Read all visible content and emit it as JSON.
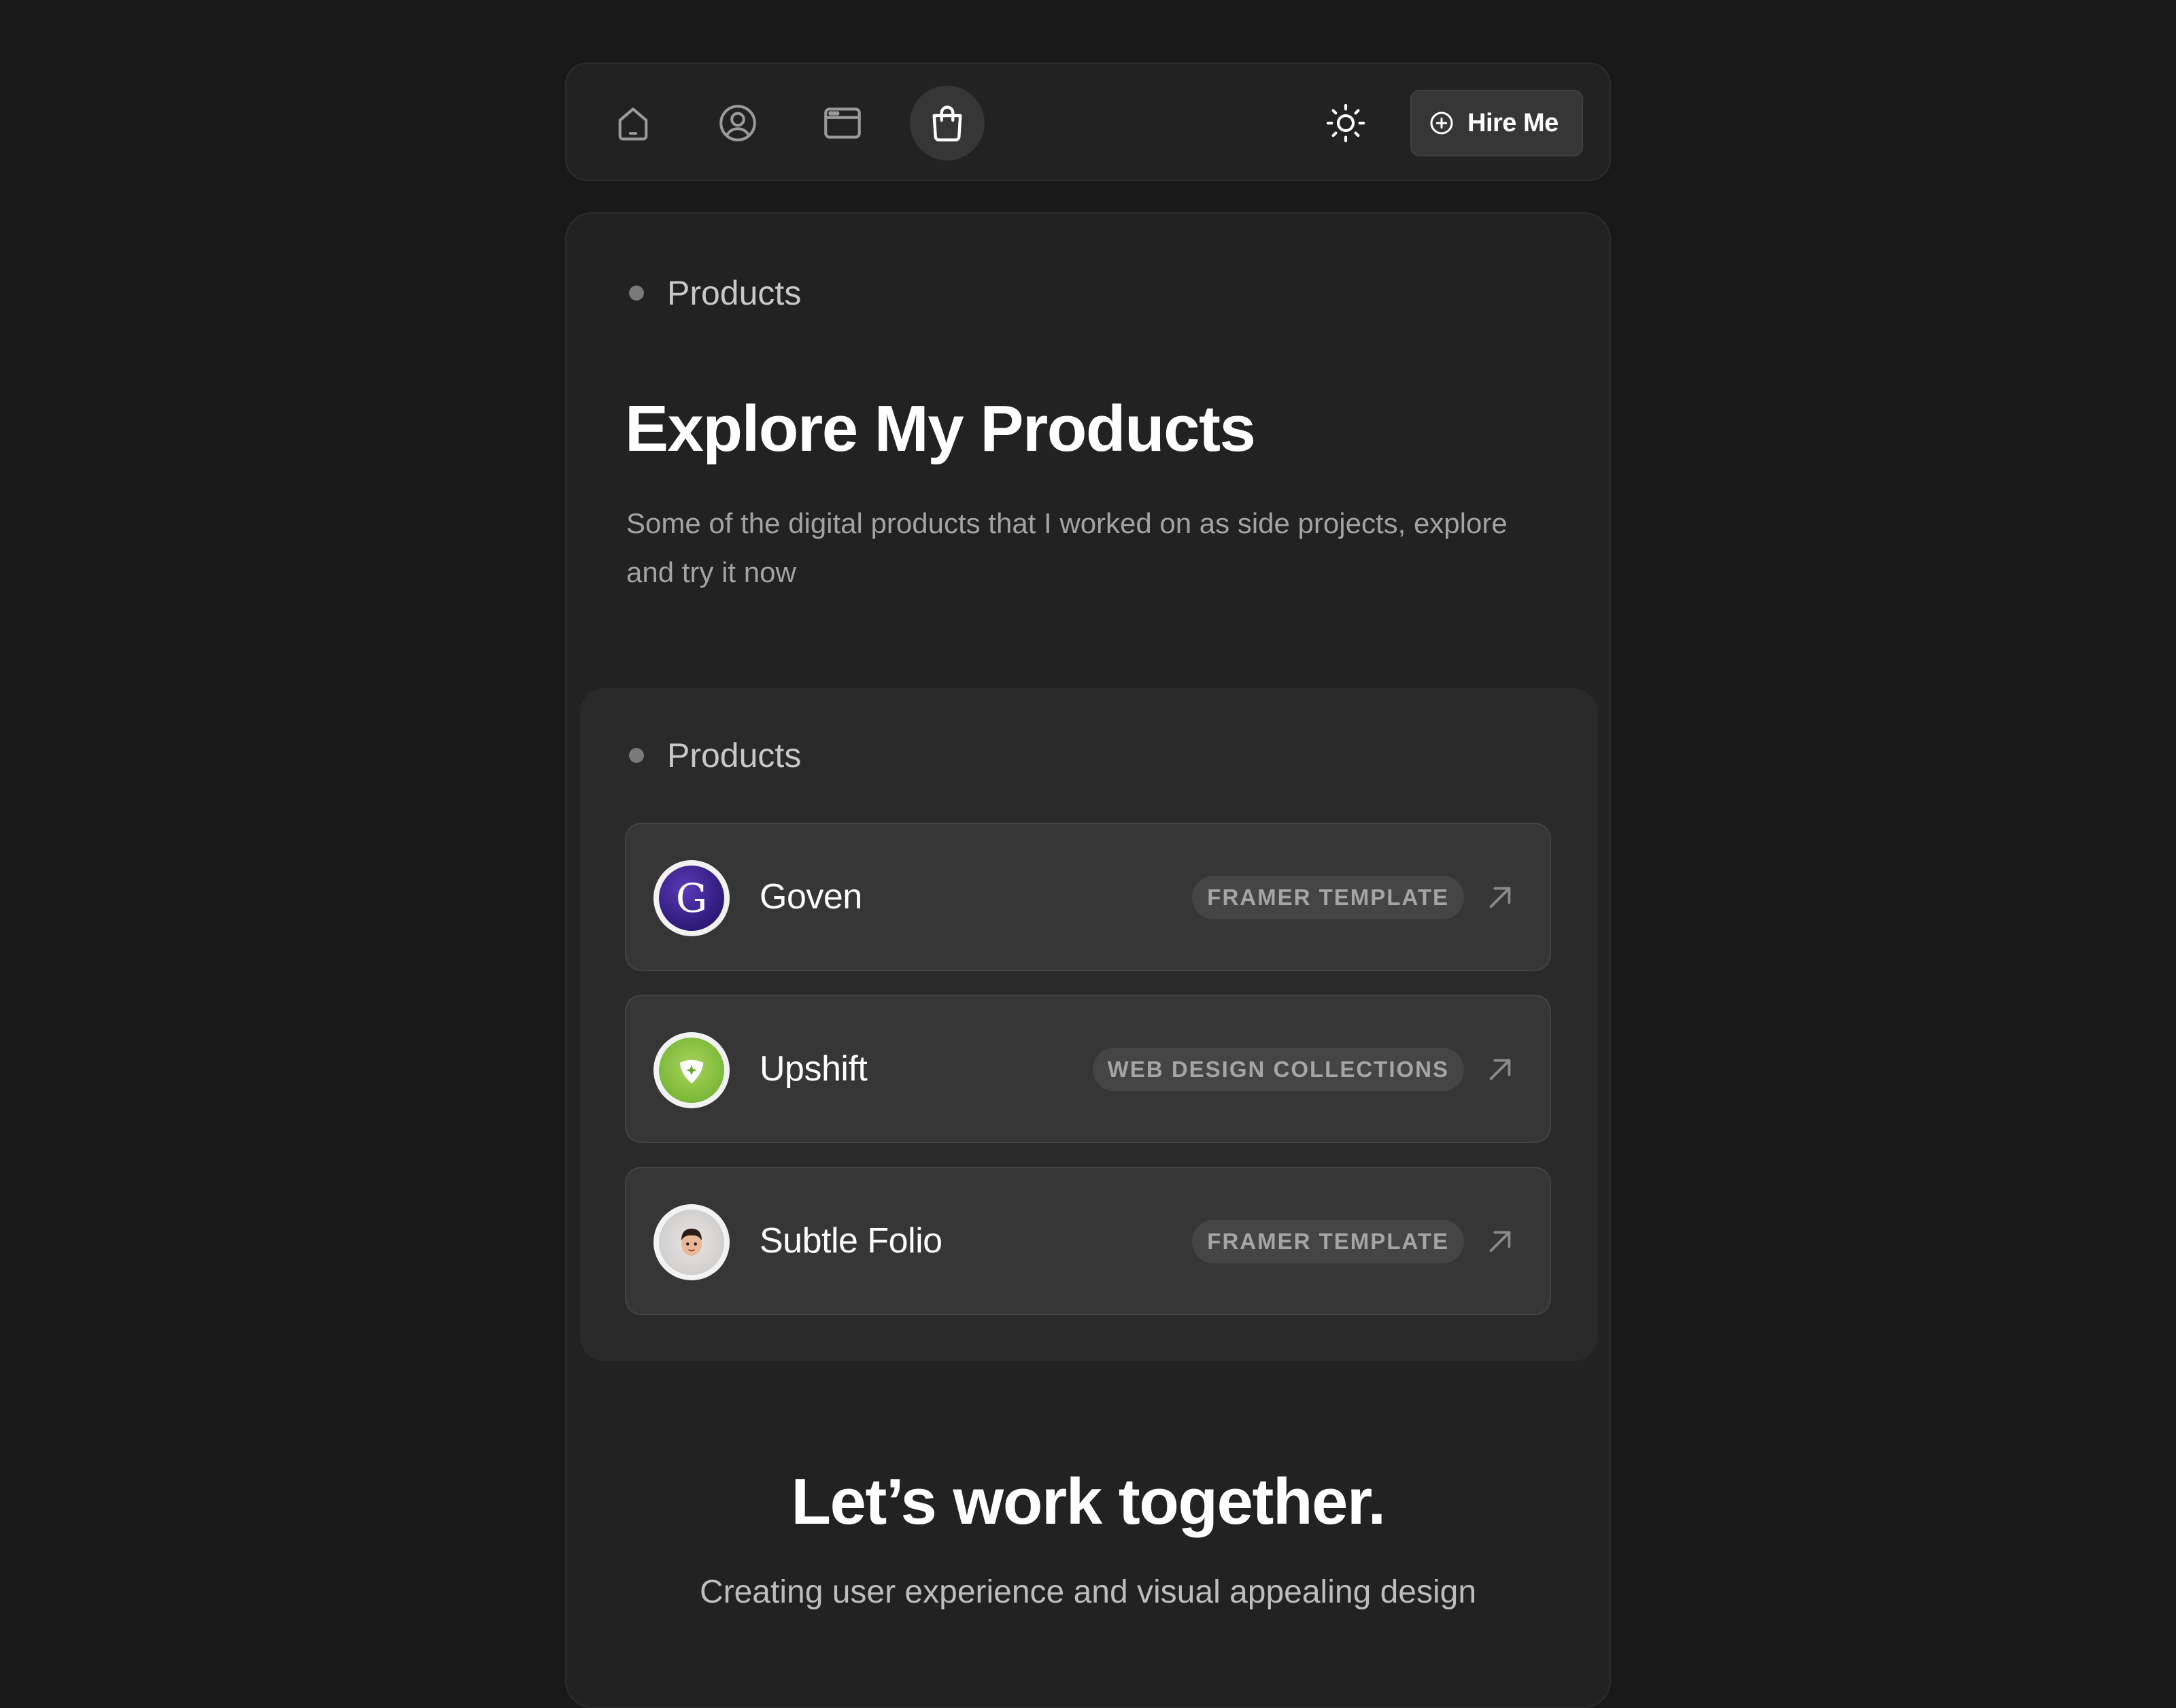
{
  "nav": {
    "items": [
      {
        "name": "home",
        "icon": "home-icon"
      },
      {
        "name": "about",
        "icon": "user-circle-icon"
      },
      {
        "name": "projects",
        "icon": "browser-window-icon"
      },
      {
        "name": "products",
        "icon": "shopping-bag-icon",
        "active": true
      }
    ],
    "theme_toggle_icon": "sun-icon",
    "hire_button": {
      "label": "Hire Me",
      "icon": "plus-circle-icon"
    }
  },
  "header": {
    "section_label": "Products",
    "title": "Explore My Products",
    "description": "Some of the digital products that I worked on as side projects, explore and try it now"
  },
  "products": {
    "section_label": "Products",
    "items": [
      {
        "name": "Goven",
        "tag": "FRAMER TEMPLATE",
        "avatar_letter": "G",
        "link_icon": "arrow-up-right-icon"
      },
      {
        "name": "Upshift",
        "tag": "WEB DESIGN COLLECTIONS",
        "link_icon": "arrow-up-right-icon"
      },
      {
        "name": "Subtle Folio",
        "tag": "FRAMER TEMPLATE",
        "link_icon": "arrow-up-right-icon"
      }
    ]
  },
  "cta": {
    "title": "Let’s work together.",
    "subtitle": "Creating user experience and visual appealing design"
  },
  "colors": {
    "background": "#191919",
    "card": "#222222",
    "panel": "#2a2a2a",
    "row": "#363636",
    "badge": "#454545",
    "goven_accent": "#3a2290",
    "upshift_accent": "#7cb83a"
  }
}
